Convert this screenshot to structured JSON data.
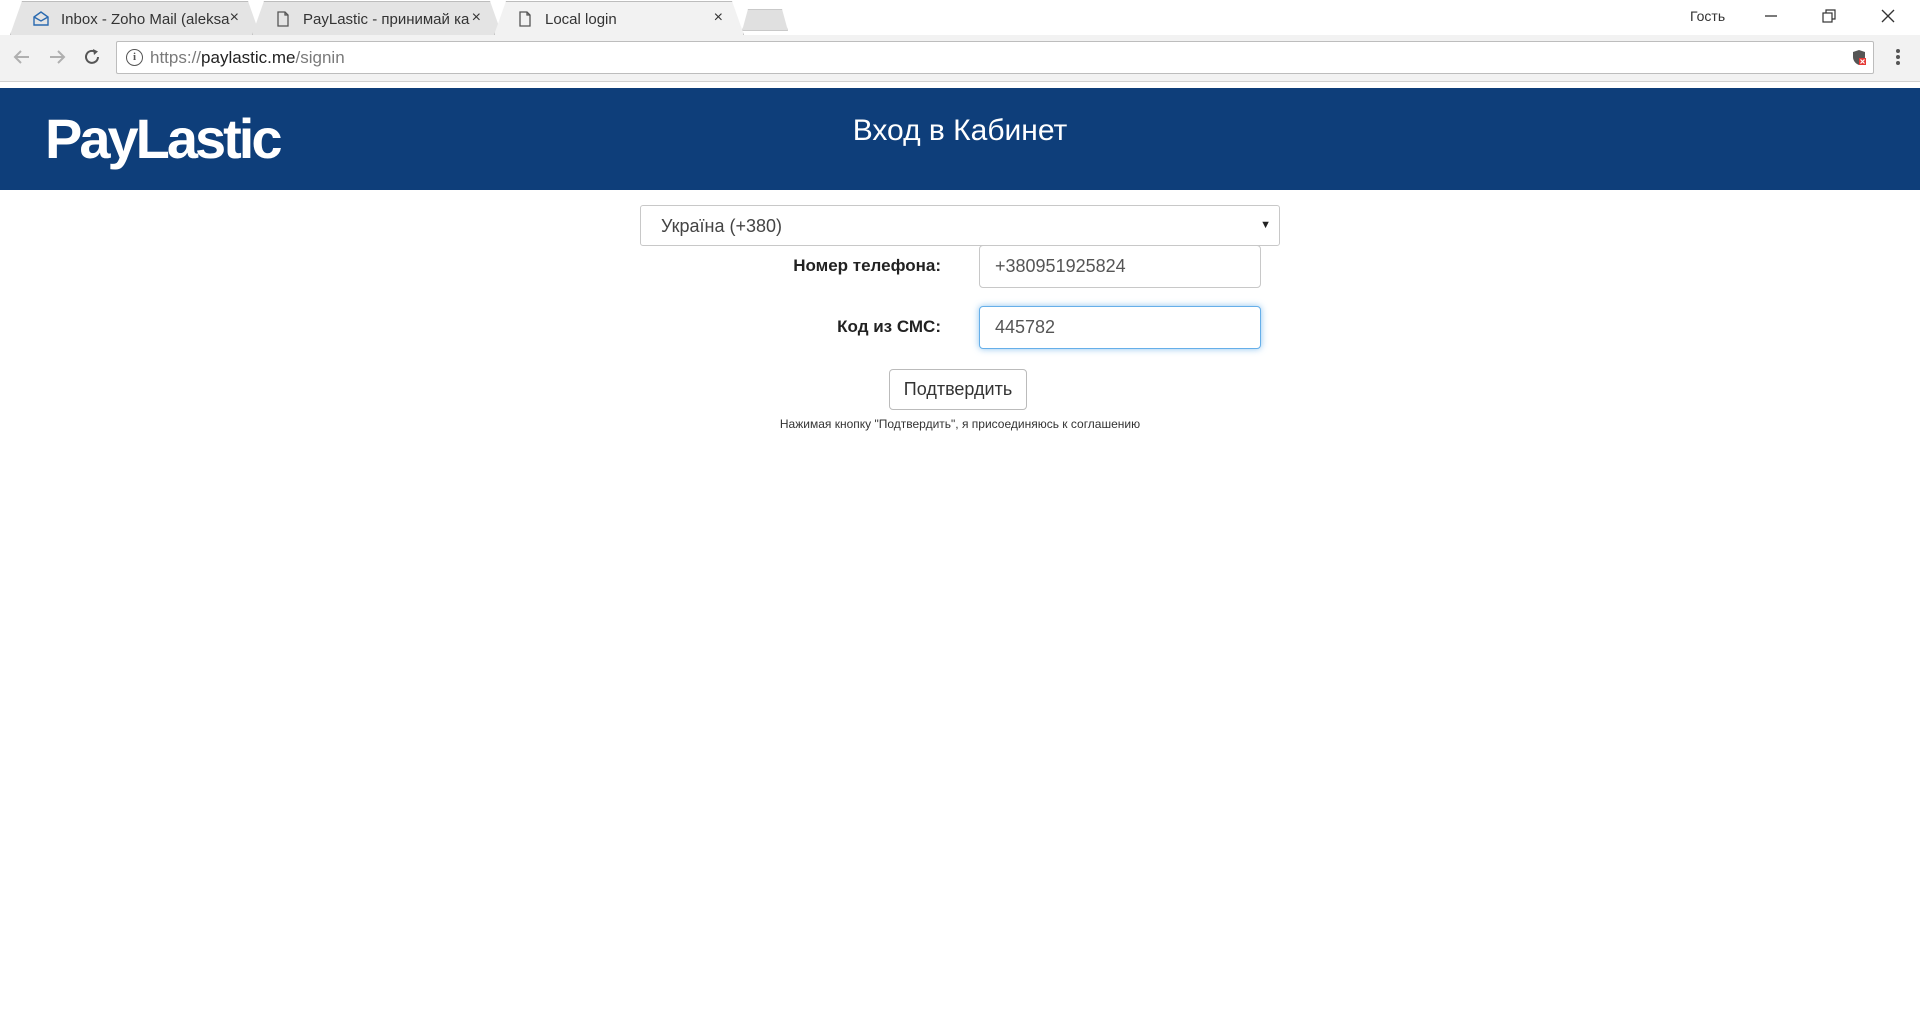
{
  "browser": {
    "tabs": [
      {
        "title": "Inbox - Zoho Mail (aleksa",
        "icon": "envelope-icon",
        "active": false
      },
      {
        "title": "PayLastic - принимай ка",
        "icon": "page-icon",
        "active": false
      },
      {
        "title": "Local login",
        "icon": "page-icon",
        "active": true
      }
    ],
    "tab_close_glyph": "×",
    "guest_label": "Гость",
    "url_scheme": "https://",
    "url_host": "paylastic.me",
    "url_path": "/signin"
  },
  "header": {
    "logo_text": "PayLastic",
    "title": "Вход в Кабинет",
    "background_color": "#0e3e7a"
  },
  "form": {
    "country_selected": "Україна (+380)",
    "phone_label": "Номер телефона:",
    "phone_value": "+380951925824",
    "sms_label": "Код из СМС:",
    "sms_value": "445782",
    "confirm_label": "Подтвердить",
    "agreement_text": "Нажимая кнопку \"Подтвердить\", я присоединяюсь к соглашению"
  }
}
